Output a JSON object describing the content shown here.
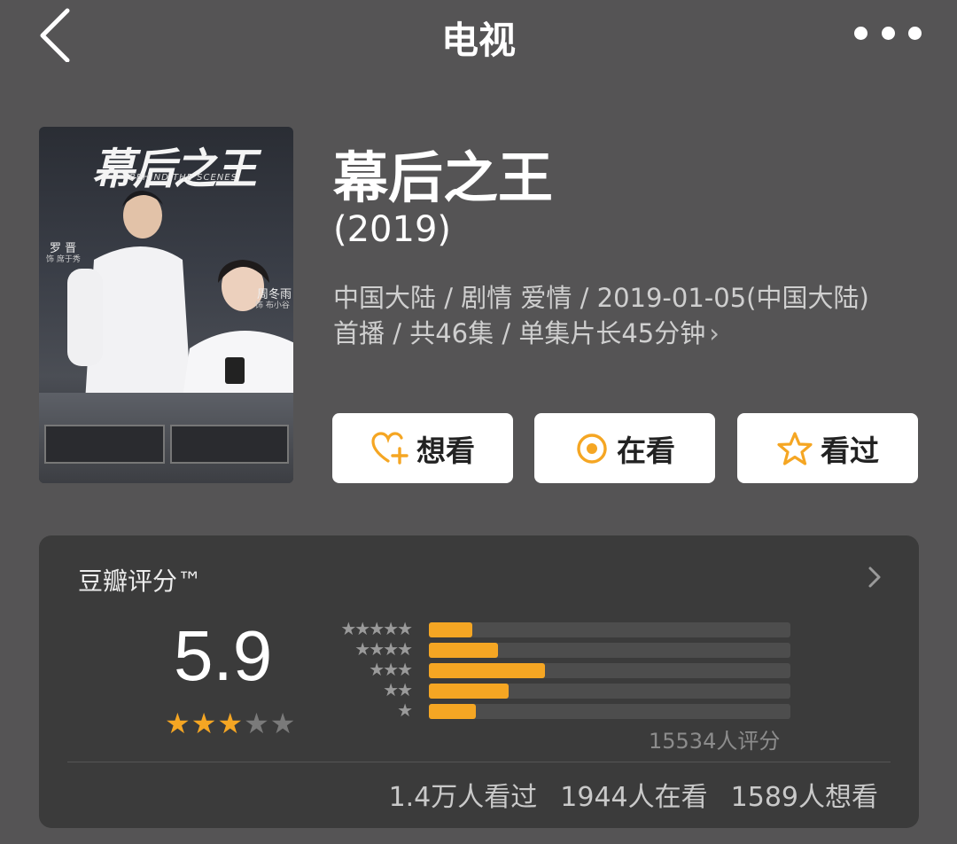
{
  "nav": {
    "title": "电视",
    "back_icon": "chevron-left-icon",
    "more_icon": "more-dots-icon"
  },
  "poster": {
    "title": "幕后之王",
    "subtitle": "BEHIND THE SCENES",
    "actor1": "罗 晋",
    "role1": "饰 席于秀",
    "actor2": "周冬雨",
    "role2": "饰 布小谷"
  },
  "show": {
    "title": "幕后之王",
    "year": "(2019)",
    "meta_line1": "中国大陆 / 剧情 爱情 / 2019-01-05(中国大陆)",
    "meta_line2": "首播 / 共46集 / 单集片长45分钟"
  },
  "actions": {
    "want": {
      "label": "想看",
      "icon": "heart-plus-icon"
    },
    "watching": {
      "label": "在看",
      "icon": "target-circle-icon"
    },
    "watched": {
      "label": "看过",
      "icon": "star-outline-icon"
    }
  },
  "rating": {
    "label": "豆瓣评分™",
    "score": "5.9",
    "stars_filled": 3,
    "stars_total": 5,
    "count_text": "15534人评分",
    "distribution": [
      {
        "stars": 5,
        "fraction": 0.12
      },
      {
        "stars": 4,
        "fraction": 0.19
      },
      {
        "stars": 3,
        "fraction": 0.32
      },
      {
        "stars": 2,
        "fraction": 0.22
      },
      {
        "stars": 1,
        "fraction": 0.13
      }
    ],
    "stats": [
      "1.4万人看过",
      "1944人在看",
      "1589人想看"
    ]
  },
  "colors": {
    "background": "#555455",
    "accent": "#f5a623",
    "card": "#3b3b3b"
  }
}
